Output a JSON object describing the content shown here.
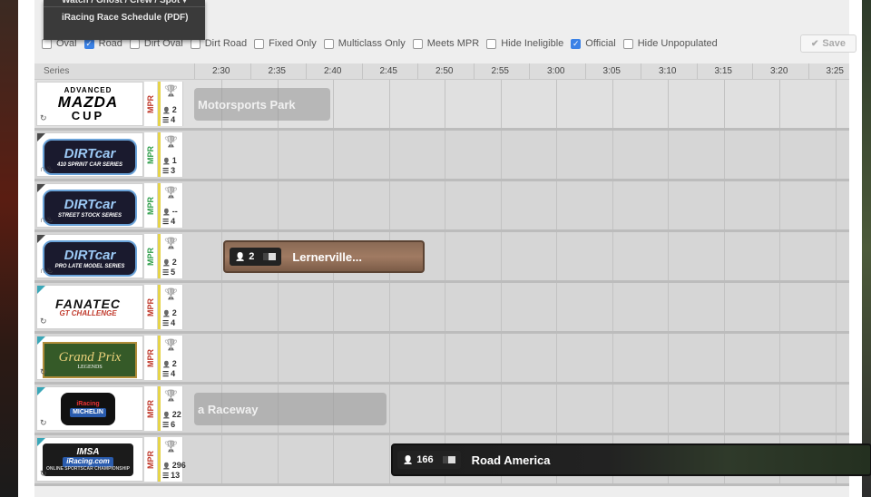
{
  "dropdown": {
    "items": [
      "Watch / Ghost / Crew / Spot ▾",
      "iRacing Race Schedule (PDF)"
    ]
  },
  "filters": [
    {
      "label": "Oval",
      "checked": false
    },
    {
      "label": "Road",
      "checked": true
    },
    {
      "label": "Dirt Oval",
      "checked": false
    },
    {
      "label": "Dirt Road",
      "checked": false
    },
    {
      "label": "Fixed Only",
      "checked": false
    },
    {
      "label": "Multiclass Only",
      "checked": false
    },
    {
      "label": "Meets MPR",
      "checked": false
    },
    {
      "label": "Hide Ineligible",
      "checked": false
    },
    {
      "label": "Official",
      "checked": true
    },
    {
      "label": "Hide Unpopulated",
      "checked": false
    }
  ],
  "save_label": "Save",
  "header": {
    "series_label": "Series",
    "times": [
      "2:30",
      "2:35",
      "2:40",
      "2:45",
      "2:50",
      "2:55",
      "3:00",
      "3:05",
      "3:10",
      "3:15",
      "3:20",
      "3:25"
    ]
  },
  "mpr_label": "MPR",
  "series": [
    {
      "logo": "mazda",
      "logo_text": [
        "ADVANCED",
        "MAZDA",
        "CUP"
      ],
      "mpr_color": "red",
      "drivers": "2",
      "sessions": "4",
      "session": {
        "style": "faded",
        "name": "Motorsports Park",
        "drivers": ""
      }
    },
    {
      "logo": "dirt",
      "logo_text": [
        "DIRTcar",
        "410 SPRINT CAR SERIES"
      ],
      "mpr_color": "green",
      "drivers": "1",
      "sessions": "3",
      "session": null
    },
    {
      "logo": "dirt",
      "logo_text": [
        "DIRTcar",
        "STREET STOCK SERIES"
      ],
      "mpr_color": "green",
      "drivers": "--",
      "sessions": "4",
      "session": null
    },
    {
      "logo": "dirt",
      "logo_text": [
        "DIRTcar",
        "PRO LATE MODEL SERIES"
      ],
      "mpr_color": "green",
      "drivers": "2",
      "sessions": "5",
      "session": {
        "style": "brown",
        "name": "Lernerville...",
        "drivers": "2"
      }
    },
    {
      "logo": "fan",
      "logo_text": [
        "FANATEC",
        "GT CHALLENGE"
      ],
      "mpr_color": "red",
      "drivers": "2",
      "sessions": "4",
      "session": null
    },
    {
      "logo": "gp",
      "logo_text": [
        "Grand Prix",
        "LEGENDS"
      ],
      "mpr_color": "red",
      "drivers": "2",
      "sessions": "4",
      "session": null
    },
    {
      "logo": "ir",
      "logo_text": [
        "iRacing",
        "MICHELIN"
      ],
      "mpr_color": "red",
      "drivers": "22",
      "sessions": "6",
      "session": {
        "style": "faded",
        "name": "a Raceway",
        "drivers": ""
      }
    },
    {
      "logo": "imsa",
      "logo_text": [
        "IMSA",
        "iRacing.com",
        "ONLINE SPORTSCAR CHAMPIONSHIP"
      ],
      "mpr_color": "red",
      "drivers": "296",
      "sessions": "13",
      "session": {
        "style": "dark",
        "name": "Road America",
        "drivers": "166"
      }
    }
  ],
  "colors": {
    "accent": "#3b82e6",
    "mpr_red": "#c0392b",
    "mpr_green": "#2e9e4a",
    "stripe": "#e6d44a"
  }
}
